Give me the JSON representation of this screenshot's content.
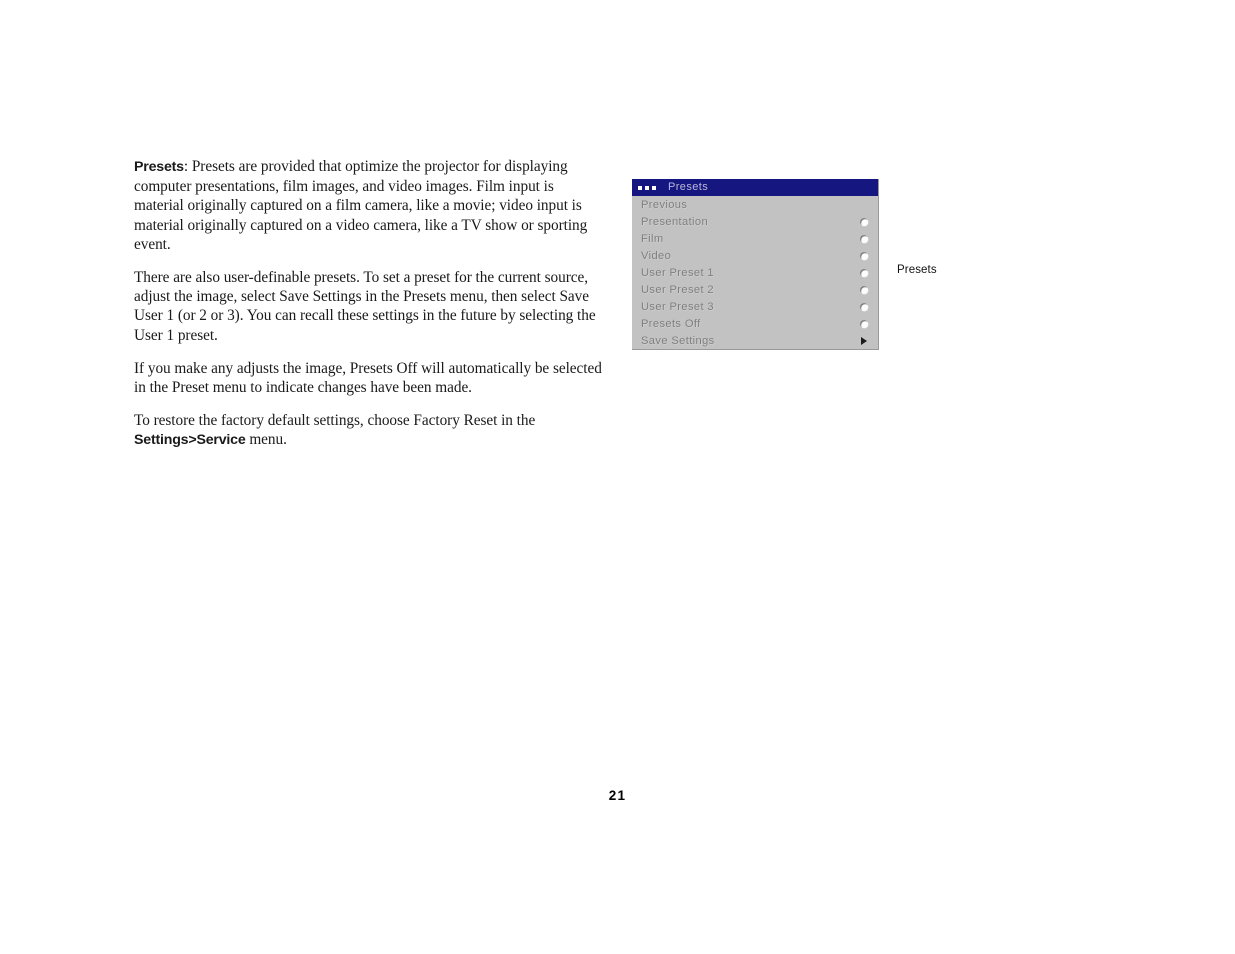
{
  "document": {
    "page_number": "21",
    "paragraphs": [
      {
        "id": "p1",
        "lead_bold": "Presets",
        "text": ": Presets are provided that optimize the projector for displaying computer presentations, film images, and video images. Film input is material originally captured on a film camera, like a movie; video input is material originally captured on a video camera, like a TV show or sporting event."
      },
      {
        "id": "p2",
        "text": "There are also user-definable presets. To set a preset for the current source, adjust the image, select Save Settings in the Presets menu, then select Save User 1 (or 2 or 3). You can recall these settings in the future by selecting the User 1 preset."
      },
      {
        "id": "p3",
        "text": "If you make any adjusts the image, Presets Off will automatically be selected in the Preset menu to indicate changes have been made."
      },
      {
        "id": "p4",
        "text_before": "To restore the factory default settings, choose Factory Reset in the ",
        "bold": "Settings>Service",
        "text_after": " menu."
      }
    ]
  },
  "osd_menu": {
    "title": "Presets",
    "title_icon": "three-dots-icon",
    "caption": "Presets",
    "colors": {
      "titlebar_background": "#161680",
      "titlebar_text": "#b9b9d8",
      "menu_background": "#c2c2c2",
      "menu_text": "#7e7e7e",
      "radio_fill": "#fdfdfd",
      "arrow": "#1b1b1b"
    },
    "items": [
      {
        "label": "Previous",
        "control": "none"
      },
      {
        "label": "Presentation",
        "control": "radio",
        "selected": false
      },
      {
        "label": "Film",
        "control": "radio",
        "selected": false
      },
      {
        "label": "Video",
        "control": "radio",
        "selected": false
      },
      {
        "label": "User Preset 1",
        "control": "radio",
        "selected": false
      },
      {
        "label": "User Preset 2",
        "control": "radio",
        "selected": false
      },
      {
        "label": "User Preset 3",
        "control": "radio",
        "selected": false
      },
      {
        "label": "Presets Off",
        "control": "radio",
        "selected": false
      },
      {
        "label": "Save Settings",
        "control": "submenu-arrow"
      }
    ]
  }
}
